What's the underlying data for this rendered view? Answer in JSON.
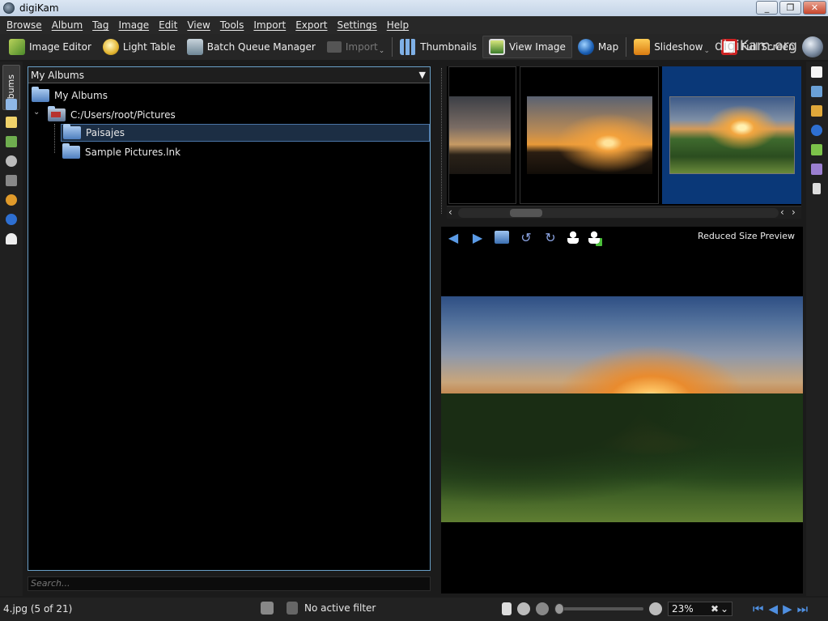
{
  "window": {
    "title": "digiKam"
  },
  "menu": [
    "Browse",
    "Album",
    "Tag",
    "Image",
    "Edit",
    "View",
    "Tools",
    "Import",
    "Export",
    "Settings",
    "Help"
  ],
  "toolbar": {
    "image_editor": "Image Editor",
    "light_table": "Light Table",
    "batch_queue": "Batch Queue Manager",
    "import": "Import",
    "thumbnails": "Thumbnails",
    "view_image": "View Image",
    "map": "Map",
    "slideshow": "Slideshow",
    "full_screen": "Full Screen",
    "brand": "digiKam.org"
  },
  "left_tabs": {
    "albums": "Albums"
  },
  "albums": {
    "combo": "My Albums",
    "root": "My Albums",
    "path": "C:/Users/root/Pictures",
    "children": [
      "Paisajes",
      "Sample Pictures.lnk"
    ]
  },
  "search": {
    "placeholder": "Search..."
  },
  "preview": {
    "label": "Reduced Size Preview"
  },
  "status": {
    "file": "4.jpg (5 of 21)",
    "filter": "No active filter",
    "zoom": "23%"
  }
}
